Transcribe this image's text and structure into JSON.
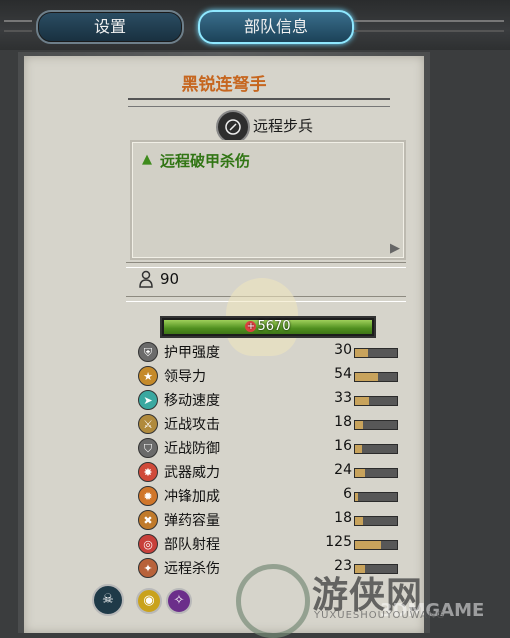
{
  "tabs": {
    "settings": "设置",
    "unit_info": "部队信息"
  },
  "unit": {
    "name": "黑锐连弩手",
    "class_icon": "compass-icon",
    "class_name": "远程步兵",
    "ability": "远程破甲杀伤",
    "men": "90",
    "hp": "5670",
    "hp_fraction": 1.0
  },
  "stats": [
    {
      "label": "护甲强度",
      "value": "30",
      "fill": 0.3,
      "icon": "armor-icon",
      "color": "#6b6b6b"
    },
    {
      "label": "领导力",
      "value": "54",
      "fill": 0.54,
      "icon": "leadership-icon",
      "color": "#c58a2a"
    },
    {
      "label": "移动速度",
      "value": "33",
      "fill": 0.33,
      "icon": "speed-icon",
      "color": "#3aa8a0"
    },
    {
      "label": "近战攻击",
      "value": "18",
      "fill": 0.18,
      "icon": "melee-attack-icon",
      "color": "#b08a3c"
    },
    {
      "label": "近战防御",
      "value": "16",
      "fill": 0.16,
      "icon": "melee-defence-icon",
      "color": "#6a6a6a"
    },
    {
      "label": "武器威力",
      "value": "24",
      "fill": 0.24,
      "icon": "weapon-power-icon",
      "color": "#d04a3a"
    },
    {
      "label": "冲锋加成",
      "value": "6",
      "fill": 0.06,
      "icon": "charge-bonus-icon",
      "color": "#d0762a"
    },
    {
      "label": "弹药容量",
      "value": "18",
      "fill": 0.18,
      "icon": "ammo-icon",
      "color": "#c07a2a"
    },
    {
      "label": "部队射程",
      "value": "125",
      "fill": 0.62,
      "icon": "range-icon",
      "color": "#c8403a"
    },
    {
      "label": "远程杀伤",
      "value": "23",
      "fill": 0.23,
      "icon": "missile-damage-icon",
      "color": "#b8623a"
    }
  ],
  "bottom_icons": [
    {
      "name": "skull-icon",
      "color": "#1f3a48"
    },
    {
      "name": "eye-icon",
      "color": "#c9a21c"
    },
    {
      "name": "claw-icon",
      "color": "#6b2e8a"
    }
  ],
  "watermark": {
    "main": "游侠网",
    "sub": "YUXUESHOUYOUWANG",
    "logo3dm": "3DMGAME"
  }
}
